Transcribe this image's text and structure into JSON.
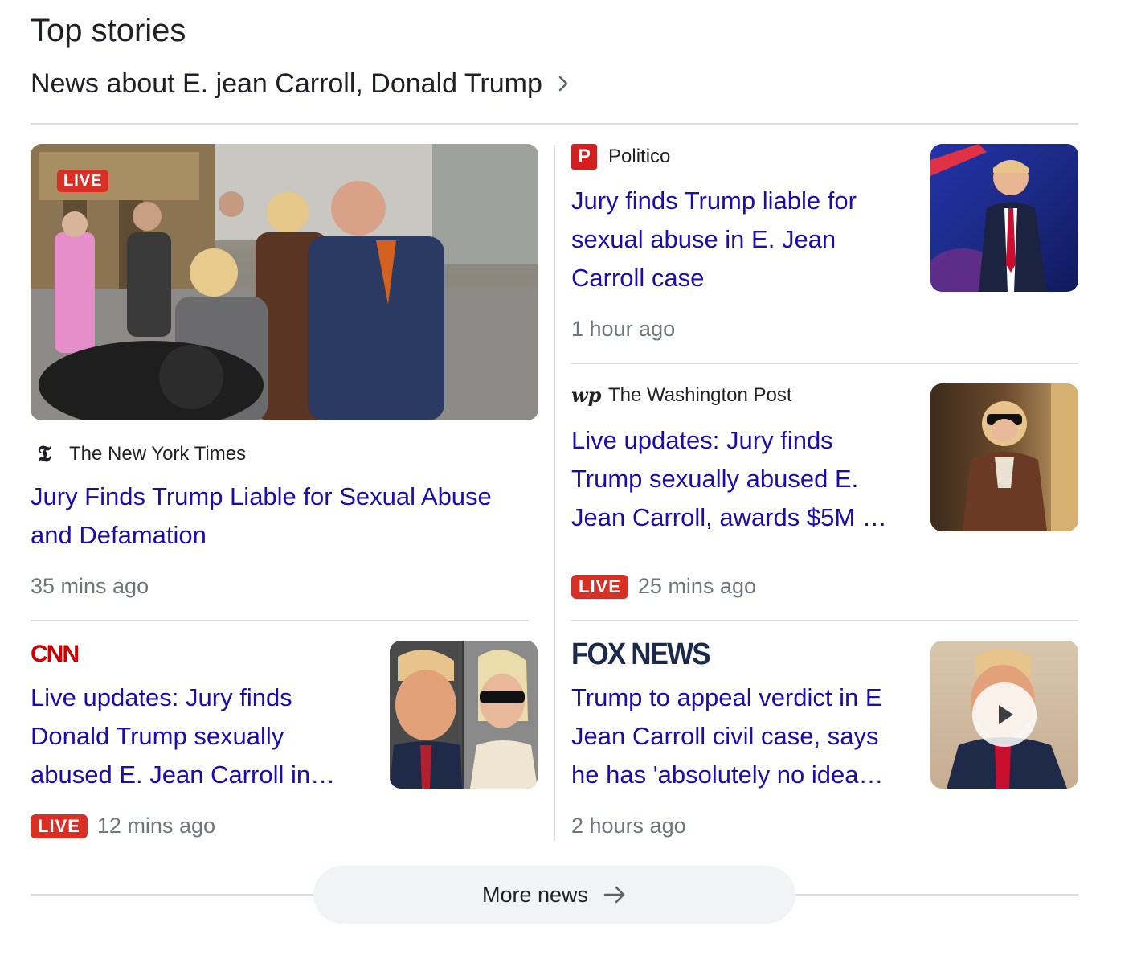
{
  "section_title": "Top stories",
  "subtitle": "News about E. jean Carroll, Donald Trump",
  "live_label": "LIVE",
  "articles": [
    {
      "source": "The New York Times",
      "source_icon": "nyt-logo-icon",
      "headline_1": "Jury Finds Trump Liable for Sexual Abuse",
      "headline_2": "and Defamation",
      "time": "35 mins ago",
      "live": true
    },
    {
      "source": "Politico",
      "source_icon": "politico-logo-icon",
      "headline_1": "Jury finds Trump liable for",
      "headline_2": "sexual abuse in E. Jean",
      "headline_3": "Carroll case",
      "time": "1 hour ago",
      "live": false
    },
    {
      "source": "The Washington Post",
      "source_icon": "wapo-logo-icon",
      "headline_1": "Live updates: Jury finds",
      "headline_2": "Trump sexually abused E.",
      "headline_3": "Jean Carroll, awards $5M …",
      "time": "25 mins ago",
      "live": true
    },
    {
      "source": "CNN",
      "source_icon": "cnn-logo-icon",
      "headline_1": "Live updates: Jury finds",
      "headline_2": "Donald Trump sexually",
      "headline_3": "abused E. Jean Carroll in…",
      "time": "12 mins ago",
      "live": true
    },
    {
      "source": "FOX NEWS",
      "source_icon": "fox-news-logo-icon",
      "headline_1": "Trump to appeal verdict in E",
      "headline_2": "Jean Carroll civil case, says",
      "headline_3": "he has 'absolutely no idea…",
      "time": "2 hours ago",
      "live": false,
      "video": true
    }
  ],
  "more_button": "More news",
  "colors": {
    "headline": "#1a0dab",
    "live_red": "#d93025",
    "muted": "#70757a",
    "divider": "#dadce0"
  }
}
